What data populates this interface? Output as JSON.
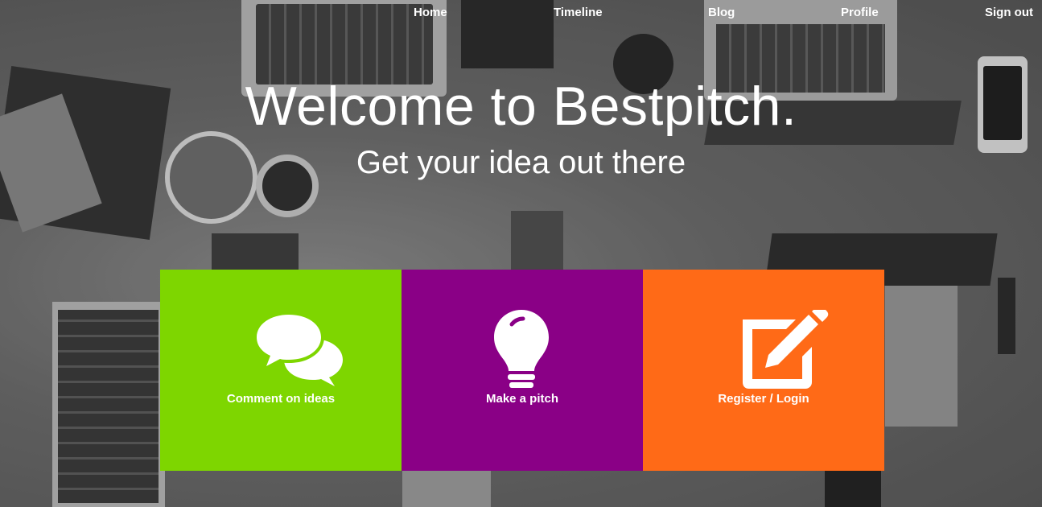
{
  "nav": {
    "items": [
      {
        "label": "Home"
      },
      {
        "label": "Timeline"
      },
      {
        "label": "Blog"
      },
      {
        "label": "Profile"
      },
      {
        "label": "Sign out"
      }
    ]
  },
  "hero": {
    "title": "Welcome to Bestpitch.",
    "subtitle": "Get your idea out there"
  },
  "cards": [
    {
      "label": "Comment on ideas",
      "icon": "comments-icon",
      "color": "#7ed600"
    },
    {
      "label": "Make a pitch",
      "icon": "lightbulb-icon",
      "color": "#8a0086"
    },
    {
      "label": "Register / Login",
      "icon": "edit-icon",
      "color": "#ff6a17"
    }
  ]
}
